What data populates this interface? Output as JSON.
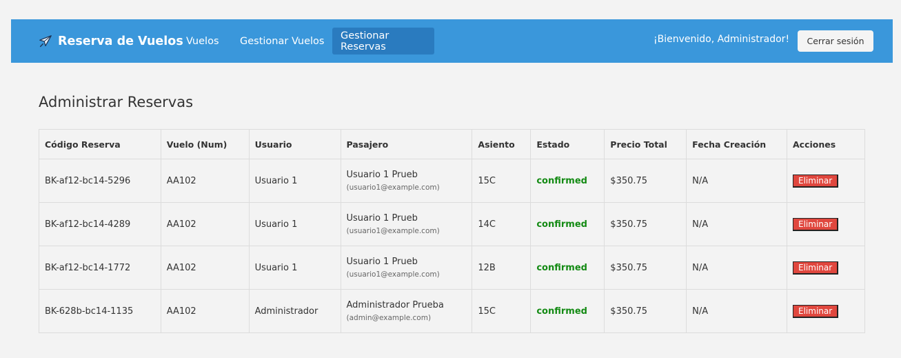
{
  "nav": {
    "brand": "Reserva de Vuelos",
    "brand_icon": "airplane-icon",
    "links": [
      {
        "label": "Vuelos",
        "active": false
      },
      {
        "label": "Gestionar Vuelos",
        "active": false
      },
      {
        "label": "Gestionar Reservas",
        "active": true
      }
    ],
    "welcome": "¡Bienvenido, Administrador!",
    "logout_label": "Cerrar sesión",
    "background_color": "#3a97db",
    "active_link_color": "#2a7bbf"
  },
  "main": {
    "title": "Administrar Reservas",
    "table": {
      "headers": [
        "Código Reserva",
        "Vuelo (Num)",
        "Usuario",
        "Pasajero",
        "Asiento",
        "Estado",
        "Precio Total",
        "Fecha Creación",
        "Acciones"
      ],
      "rows": [
        {
          "codigo": "BK-af12-bc14-5296",
          "vuelo": "AA102",
          "usuario": "Usuario 1",
          "pasajero_nombre": "Usuario 1 Prueb",
          "pasajero_email": "(usuario1@example.com)",
          "asiento": "15C",
          "estado": "confirmed",
          "precio": "$350.75",
          "fecha": "N/A",
          "accion": "Eliminar"
        },
        {
          "codigo": "BK-af12-bc14-4289",
          "vuelo": "AA102",
          "usuario": "Usuario 1",
          "pasajero_nombre": "Usuario 1 Prueb",
          "pasajero_email": "(usuario1@example.com)",
          "asiento": "14C",
          "estado": "confirmed",
          "precio": "$350.75",
          "fecha": "N/A",
          "accion": "Eliminar"
        },
        {
          "codigo": "BK-af12-bc14-1772",
          "vuelo": "AA102",
          "usuario": "Usuario 1",
          "pasajero_nombre": "Usuario 1 Prueb",
          "pasajero_email": "(usuario1@example.com)",
          "asiento": "12B",
          "estado": "confirmed",
          "precio": "$350.75",
          "fecha": "N/A",
          "accion": "Eliminar"
        },
        {
          "codigo": "BK-628b-bc14-1135",
          "vuelo": "AA102",
          "usuario": "Administrador",
          "pasajero_nombre": "Administrador Prueba",
          "pasajero_email": "(admin@example.com)",
          "asiento": "15C",
          "estado": "confirmed",
          "precio": "$350.75",
          "fecha": "N/A",
          "accion": "Eliminar"
        }
      ]
    },
    "status_color": "#138a13",
    "delete_button_color": "#e0473e"
  }
}
